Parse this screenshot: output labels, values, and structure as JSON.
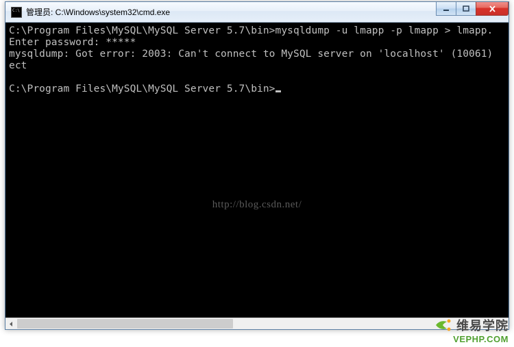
{
  "window": {
    "title": "管理员: C:\\Windows\\system32\\cmd.exe"
  },
  "console": {
    "line1": "C:\\Program Files\\MySQL\\MySQL Server 5.7\\bin>mysqldump -u lmapp -p lmapp > lmapp.",
    "line2": "Enter password: *****",
    "line3": "mysqldump: Got error: 2003: Can't connect to MySQL server on 'localhost' (10061)",
    "line4": "ect",
    "line5": "",
    "line6": "C:\\Program Files\\MySQL\\MySQL Server 5.7\\bin>"
  },
  "watermark": "http://blog.csdn.net/",
  "logo": {
    "cn": "维易学院",
    "url": "VEPHP.COM"
  }
}
